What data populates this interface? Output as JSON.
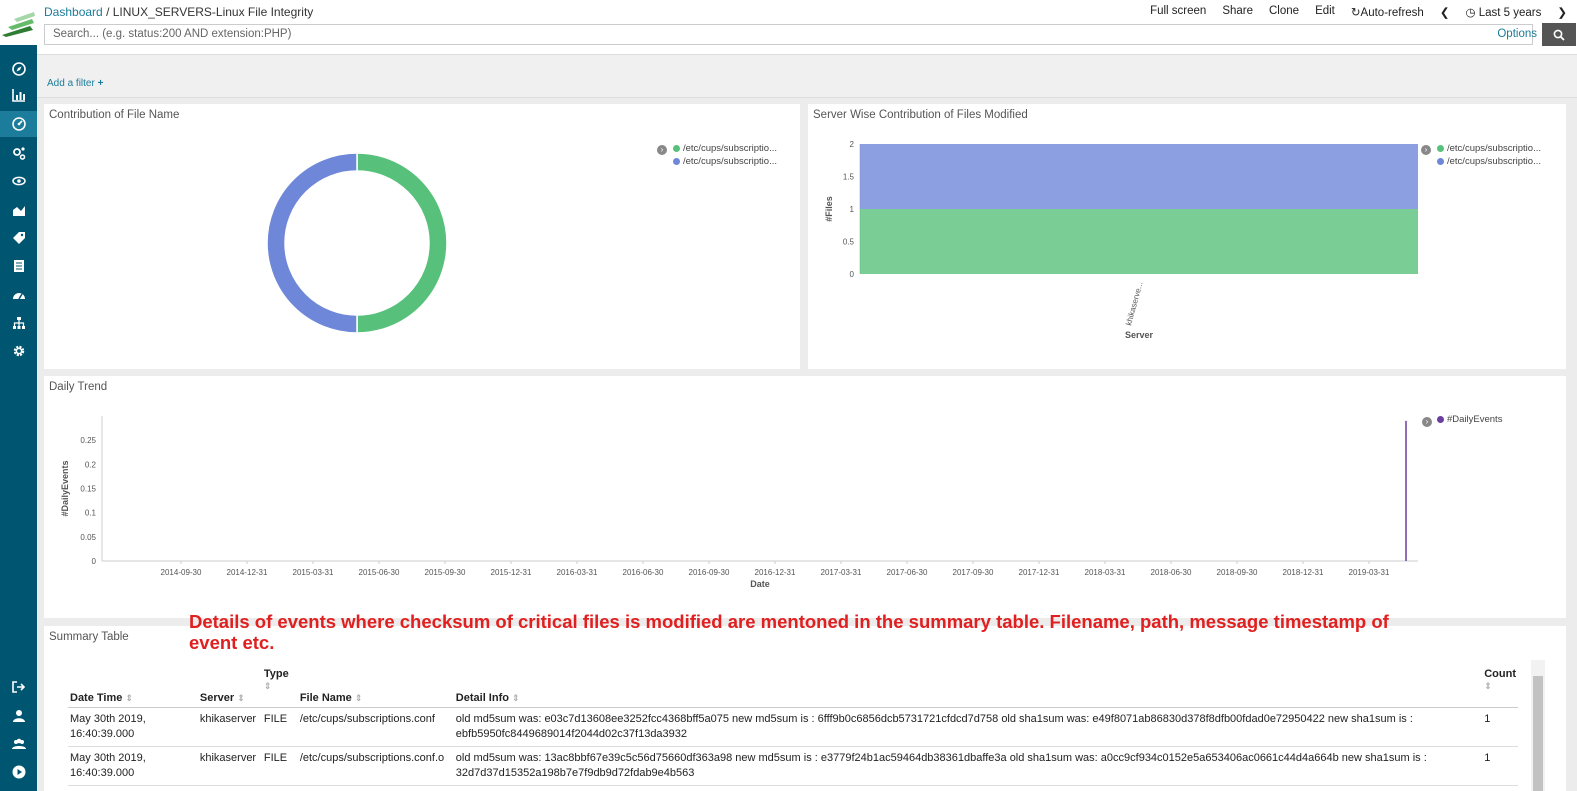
{
  "breadcrumb": {
    "root": "Dashboard",
    "separator": "/",
    "current": "LINUX_SERVERS-Linux File Integrity"
  },
  "topmenu": {
    "fullscreen": "Full screen",
    "share": "Share",
    "clone": "Clone",
    "edit": "Edit",
    "autorefresh": "Auto-refresh",
    "timerange": "Last 5 years"
  },
  "search": {
    "placeholder": "Search... (e.g. status:200 AND extension:PHP)",
    "options": "Options"
  },
  "filter": {
    "add": "Add a filter"
  },
  "panels": {
    "contribution": {
      "title": "Contribution of File Name",
      "legend": [
        "/etc/cups/subscriptio...",
        "/etc/cups/subscriptio..."
      ]
    },
    "server_wise": {
      "title": "Server Wise Contribution of Files Modified",
      "legend": [
        "/etc/cups/subscriptio...",
        "/etc/cups/subscriptio..."
      ],
      "ylabel": "#Files",
      "xlabel": "Server",
      "xtick": "khikaserve...",
      "yticks": [
        "2",
        "1.5",
        "1",
        "0.5",
        "0"
      ]
    },
    "daily_trend": {
      "title": "Daily Trend",
      "legend": [
        "#DailyEvents"
      ],
      "ylabel": "#DailyEvents",
      "xlabel": "Date",
      "yticks": [
        "0.25",
        "0.2",
        "0.15",
        "0.1",
        "0.05",
        "0"
      ],
      "xticks": [
        "2014-09-30",
        "2014-12-31",
        "2015-03-31",
        "2015-06-30",
        "2015-09-30",
        "2015-12-31",
        "2016-03-31",
        "2016-06-30",
        "2016-09-30",
        "2016-12-31",
        "2017-03-31",
        "2017-06-30",
        "2017-09-30",
        "2017-12-31",
        "2018-03-31",
        "2018-06-30",
        "2018-09-30",
        "2018-12-31",
        "2019-03-31"
      ]
    },
    "summary": {
      "title": "Summary Table"
    }
  },
  "annotation": "Details of events where checksum of critical files is modified are mentoned in the summary table. Filename, path, message timestamp of event etc.",
  "table": {
    "headers": {
      "datetime": "Date Time",
      "server": "Server",
      "type": "Type",
      "filename": "File Name",
      "detail": "Detail Info",
      "count": "Count"
    },
    "rows": [
      {
        "datetime1": "May 30th 2019,",
        "datetime2": "16:40:39.000",
        "server": "khikaserver",
        "type": "FILE",
        "filename": "/etc/cups/subscriptions.conf",
        "detail1": "old md5sum was: e03c7d13608ee3252fcc4368bff5a075 new md5sum is : 6fff9b0c6856dcb5731721cfdcd7d758 old sha1sum was: e49f8071ab86830d378f8dfb00fdad0e72950422 new sha1sum is :",
        "detail2": "ebfb5950fc8449689014f2044d02c37f13da3932",
        "count": "1"
      },
      {
        "datetime1": "May 30th 2019,",
        "datetime2": "16:40:39.000",
        "server": "khikaserver",
        "type": "FILE",
        "filename": "/etc/cups/subscriptions.conf.o",
        "detail1": "old md5sum was: 13ac8bbf67e39c5c56d75660df363a98 new md5sum is : e3779f24b1ac59464db38361dbaffe3a old sha1sum was: a0cc9cf934c0152e5a653406ac0661c44d4a664b new sha1sum is :",
        "detail2": "32d7d37d15352a198b7e7f9db9d72fdab9e4b563",
        "count": "1"
      }
    ]
  },
  "colors": {
    "sidebar": "#005571",
    "green": "#57c17b",
    "blue": "#6f87d8",
    "purple": "#6b3fa0",
    "link": "#1b7c9b",
    "annotation": "#e02020"
  },
  "chart_data": [
    {
      "type": "pie",
      "title": "Contribution of File Name",
      "categories": [
        "/etc/cups/subscriptio...",
        "/etc/cups/subscriptio..."
      ],
      "values": [
        1,
        1
      ],
      "donut": true
    },
    {
      "type": "bar",
      "title": "Server Wise Contribution of Files Modified",
      "stacked": true,
      "categories": [
        "khikaserve..."
      ],
      "xlabel": "Server",
      "ylabel": "#Files",
      "ylim": [
        0,
        2
      ],
      "series": [
        {
          "name": "/etc/cups/subscriptio...",
          "values": [
            1
          ]
        },
        {
          "name": "/etc/cups/subscriptio...",
          "values": [
            1
          ]
        }
      ]
    },
    {
      "type": "bar",
      "title": "Daily Trend",
      "xlabel": "Date",
      "ylabel": "#DailyEvents",
      "ylim": [
        0,
        0.3
      ],
      "series": [
        {
          "name": "#DailyEvents",
          "x": [
            "2019-05-30"
          ],
          "values": [
            0.29
          ]
        }
      ]
    }
  ]
}
